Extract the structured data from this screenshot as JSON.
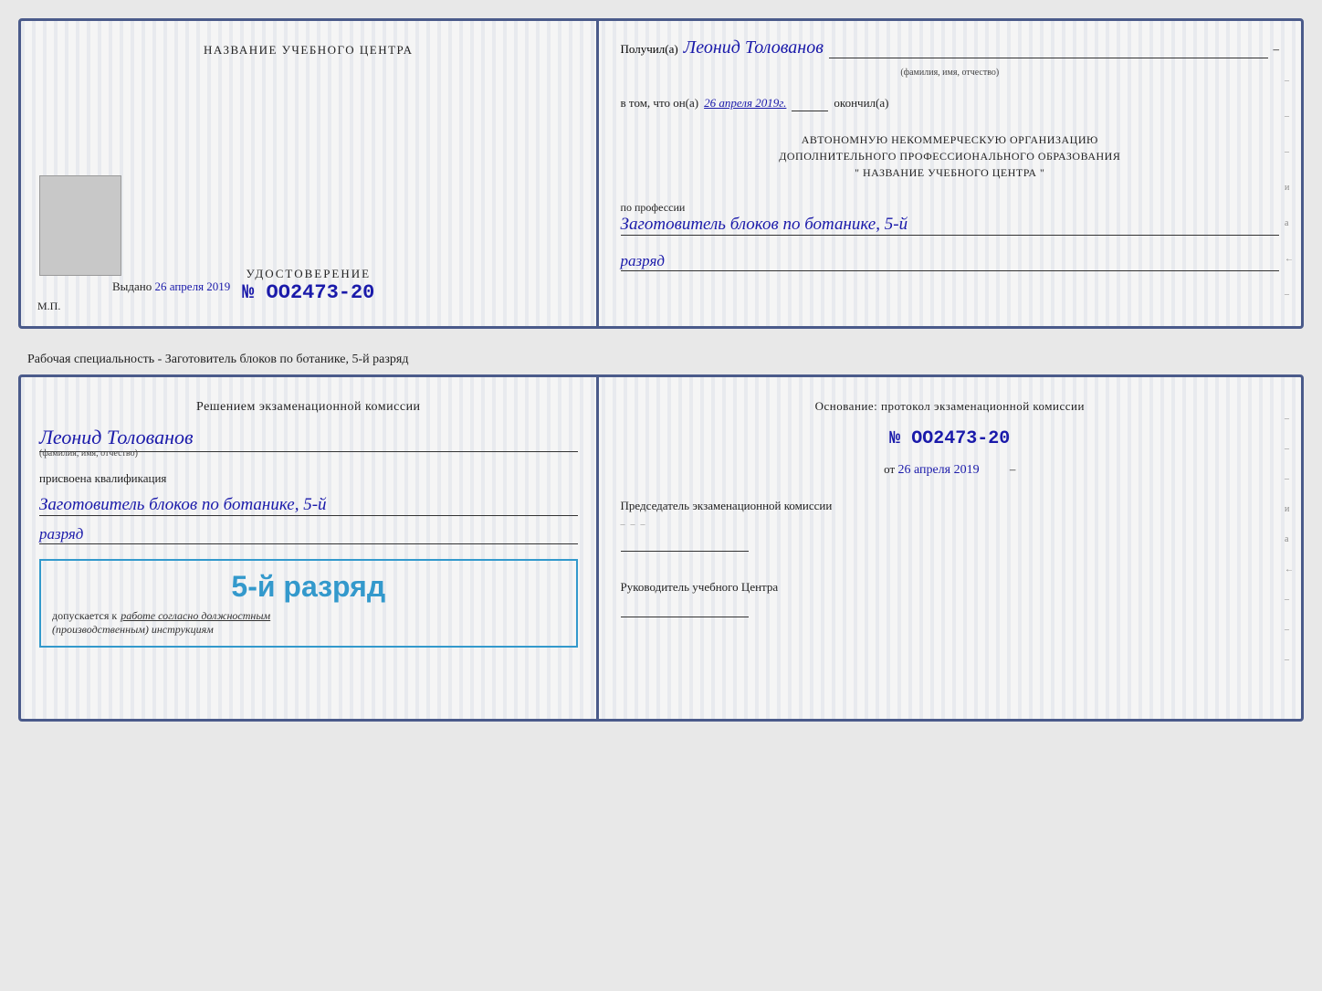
{
  "top_doc": {
    "left": {
      "header": "НАЗВАНИЕ УЧЕБНОГО ЦЕНТРА",
      "cert_title": "УДОСТОВЕРЕНИЕ",
      "cert_number": "№ OO2473-20",
      "issued_label": "Выдано",
      "issued_date": "26 апреля 2019",
      "mp_label": "М.П."
    },
    "right": {
      "received_prefix": "Получил(а)",
      "recipient_name": "Леонид Толованов",
      "name_subtitle": "(фамилия, имя, отчество)",
      "date_prefix": "в том, что он(а)",
      "date_value": "26 апреля 2019г.",
      "date_suffix": "окончил(а)",
      "org_line1": "АВТОНОМНУЮ НЕКОММЕРЧЕСКУЮ ОРГАНИЗАЦИЮ",
      "org_line2": "ДОПОЛНИТЕЛЬНОГО ПРОФЕССИОНАЛЬНОГО ОБРАЗОВАНИЯ",
      "org_line3": "\"  НАЗВАНИЕ УЧЕБНОГО ЦЕНТРА  \"",
      "profession_label": "по профессии",
      "profession_value": "Заготовитель блоков по ботанике, 5-й",
      "rank_value": "разряд",
      "dash_marks": [
        "-",
        "-",
        "-",
        "и",
        "а",
        "←",
        "-"
      ]
    }
  },
  "caption": {
    "text": "Рабочая специальность - Заготовитель блоков по ботанике, 5-й разряд"
  },
  "bottom_doc": {
    "left": {
      "decision_line1": "Решением экзаменационной комиссии",
      "name": "Леонид Толованов",
      "name_subtitle": "(фамилия, имя, отчество)",
      "assigned_label": "присвоена квалификация",
      "qualification": "Заготовитель блоков по ботанике, 5-й",
      "rank": "разряд",
      "stamp_rank": "5-й разряд",
      "stamp_permission_prefix": "допускается к",
      "stamp_permission_link": "работе согласно должностным",
      "stamp_permission_suffix": "(производственным) инструкциям"
    },
    "right": {
      "basis_label": "Основание: протокол экзаменационной комиссии",
      "protocol_number": "№  OO2473-20",
      "date_prefix": "от",
      "date_value": "26 апреля 2019",
      "chairman_label": "Председатель экзаменационной\nкомиссии",
      "director_label": "Руководитель учебного\nЦентра",
      "dash_marks": [
        "-",
        "-",
        "-",
        "и",
        "а",
        "←",
        "-",
        "-",
        "-"
      ]
    }
  }
}
